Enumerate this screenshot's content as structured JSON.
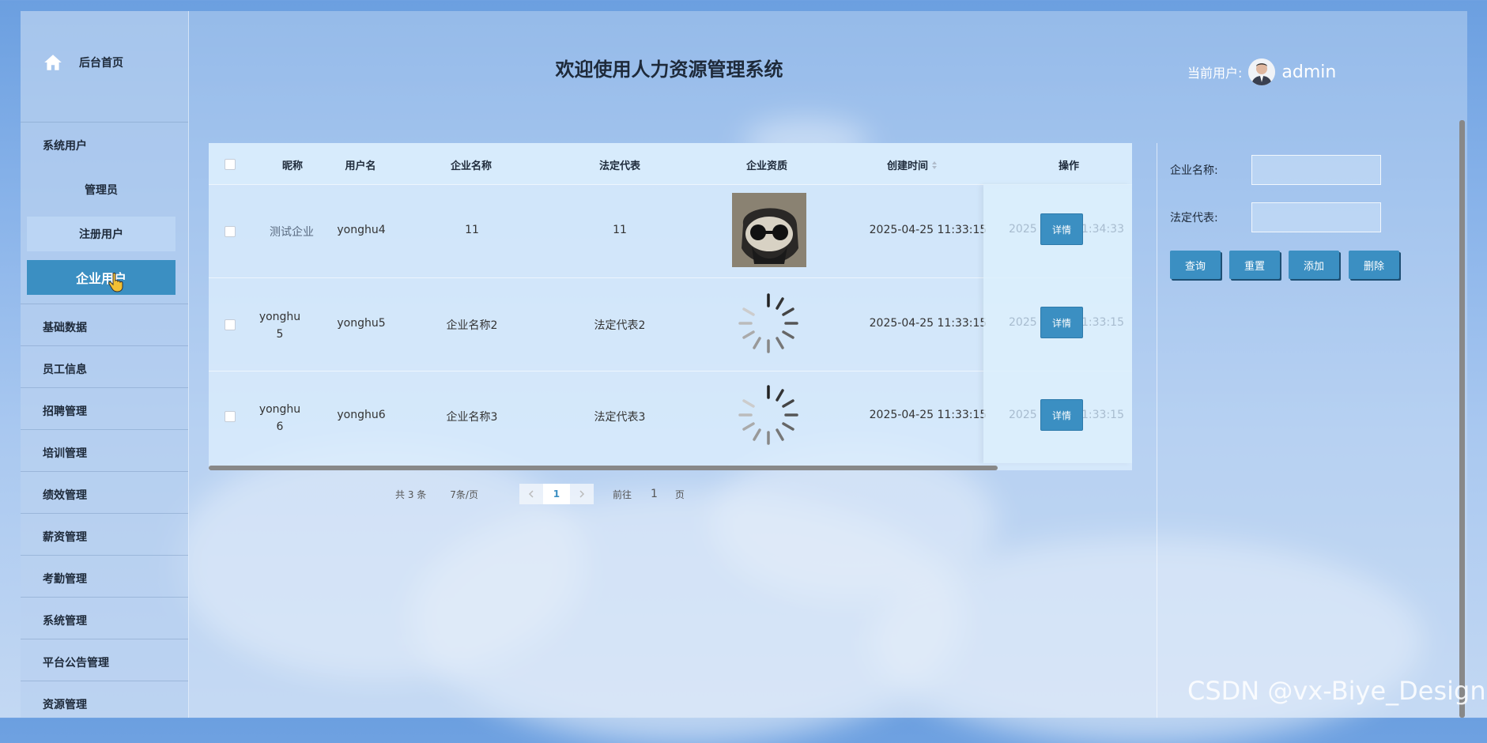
{
  "sidebar": {
    "home_label": "后台首页",
    "sections": {
      "system_users": "系统用户",
      "sub_items": [
        "管理员",
        "注册用户",
        "企业用户"
      ],
      "items": [
        "基础数据",
        "员工信息",
        "招聘管理",
        "培训管理",
        "绩效管理",
        "薪资管理",
        "考勤管理",
        "系统管理",
        "平台公告管理",
        "资源管理"
      ]
    }
  },
  "header": {
    "title": "欢迎使用人力资源管理系统",
    "current_user_label": "当前用户:",
    "username": "admin"
  },
  "table": {
    "columns": [
      "昵称",
      "用户名",
      "企业名称",
      "法定代表",
      "企业资质",
      "创建时间",
      "操作"
    ],
    "rows": [
      {
        "nickname": "测试企业",
        "username": "yonghu4",
        "company": "11",
        "legal_rep": "11",
        "qualification": "image",
        "created": "2025-04-25 11:33:15",
        "ghost_prefix": "2025",
        "ghost_suffix": "1:34:33",
        "action": "详情"
      },
      {
        "nickname": "yonghu\n5",
        "nickname_l1": "yonghu",
        "nickname_l2": "5",
        "username": "yonghu5",
        "company": "企业名称2",
        "legal_rep": "法定代表2",
        "qualification": "loading",
        "created": "2025-04-25 11:33:15",
        "ghost_prefix": "2025",
        "ghost_suffix": "1:33:15",
        "action": "详情"
      },
      {
        "nickname_l1": "yonghu",
        "nickname_l2": "6",
        "username": "yonghu6",
        "company": "企业名称3",
        "legal_rep": "法定代表3",
        "qualification": "loading",
        "created": "2025-04-25 11:33:15",
        "ghost_prefix": "2025",
        "ghost_suffix": "1:33:15",
        "action": "详情"
      }
    ]
  },
  "pagination": {
    "total": "共 3 条",
    "page_size": "7条/页",
    "current_page": "1",
    "goto_label": "前往",
    "goto_value": "1",
    "page_suffix": "页"
  },
  "search": {
    "company_label": "企业名称:",
    "legal_rep_label": "法定代表:",
    "buttons": [
      "查询",
      "重置",
      "添加",
      "删除"
    ]
  },
  "watermark": "CSDN @vx-Biye_Design",
  "colors": {
    "accent": "#3b8fc2"
  }
}
